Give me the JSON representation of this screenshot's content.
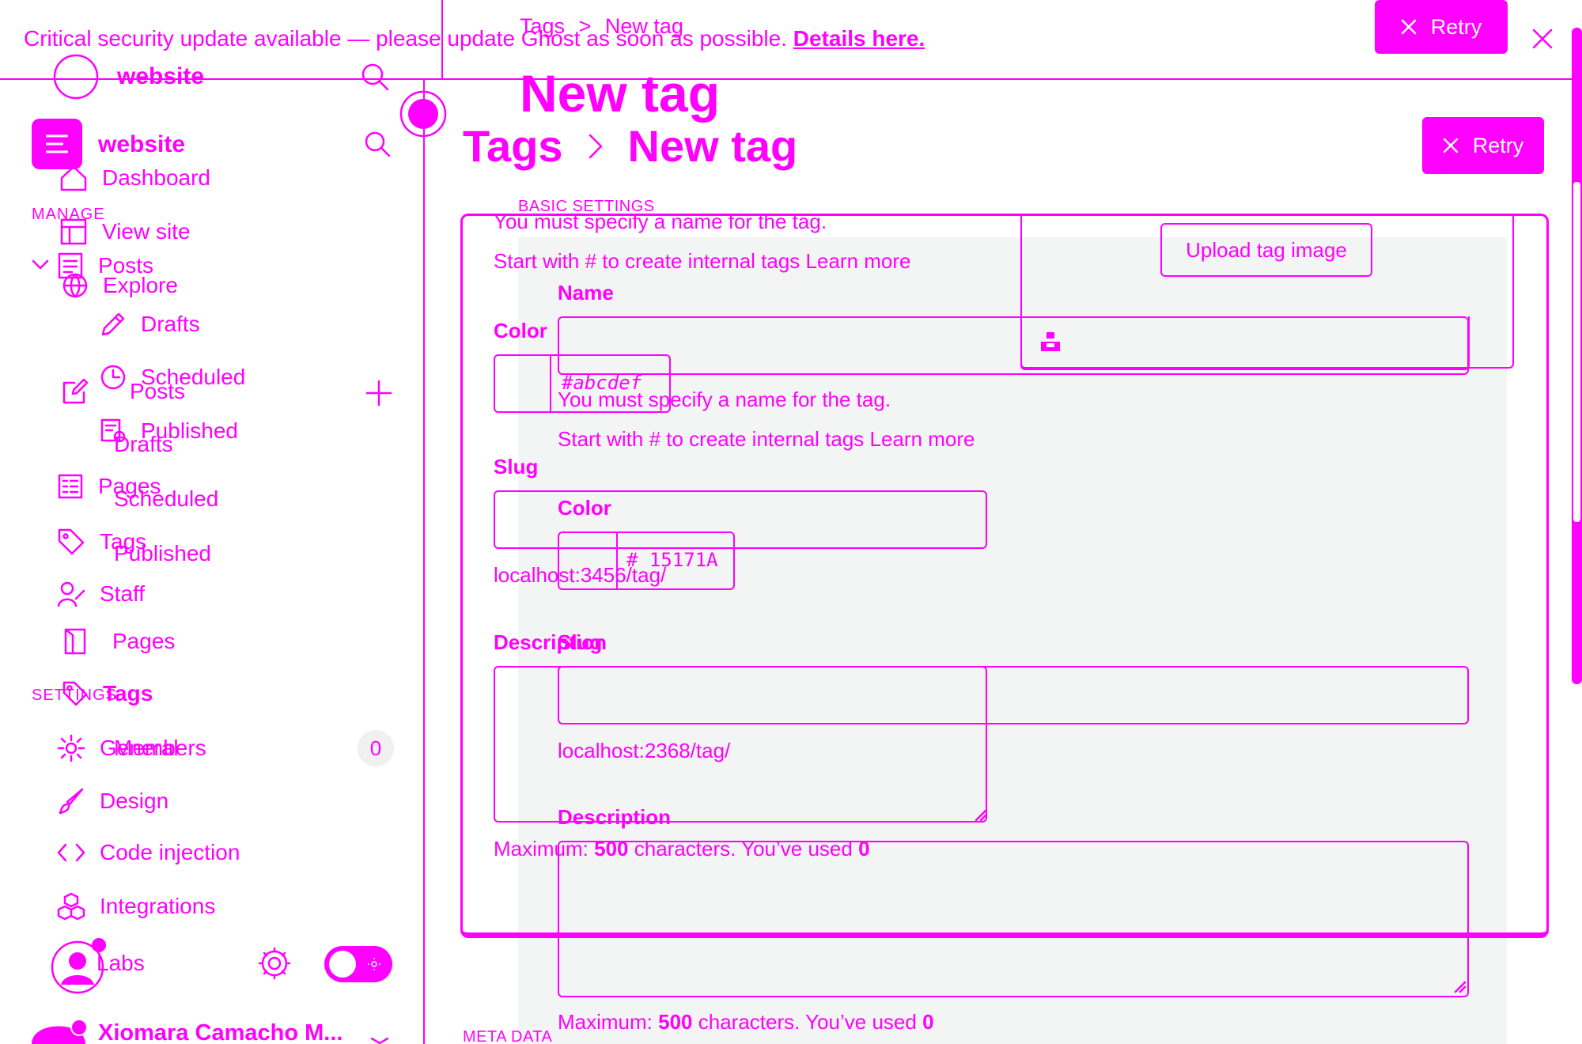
{
  "banner": {
    "text": "Critical security update available — please update Ghost as soon as possible.",
    "link": "Details here."
  },
  "site": {
    "name": "website"
  },
  "header": {
    "breadcrumb_parent": "Tags",
    "breadcrumb_current": "New tag",
    "title": "New tag",
    "retry_label": "Retry"
  },
  "sidebar": {
    "manage_heading": "MANAGE",
    "settings_heading": "SETTINGS",
    "items": {
      "dashboard": "Dashboard",
      "view_site": "View site",
      "explore": "Explore",
      "posts": "Posts",
      "drafts": "Drafts",
      "scheduled": "Scheduled",
      "published": "Published",
      "pages": "Pages",
      "tags": "Tags",
      "members": "Members",
      "members_count": "0",
      "staff": "Staff",
      "general": "General",
      "design": "Design",
      "code_injection": "Code injection",
      "integrations": "Integrations",
      "labs": "Labs"
    },
    "user_name": "Xiomara Camacho M..."
  },
  "form": {
    "section_basic": "BASIC SETTINGS",
    "section_meta": "META DATA",
    "name_label": "Name",
    "name_error": "You must specify a name for the tag.",
    "name_hint": "Start with # to create internal tags Learn more",
    "color_label": "Color",
    "color_placeholder": "#abcdef",
    "color_value_hash": "#",
    "color_value": "15171A",
    "slug_label": "Slug",
    "slug_url": "localhost:3456/tag/",
    "slug_url_2": "localhost:2368/tag/",
    "description_label": "Description",
    "max_prefix": "Maximum:",
    "max_value": "500",
    "max_middle": "characters. You’ve used",
    "max_used": "0",
    "upload_label": "Upload tag image"
  },
  "colors": {
    "accent": "#ff00ff",
    "panel_bg": "#f3f4f4"
  }
}
